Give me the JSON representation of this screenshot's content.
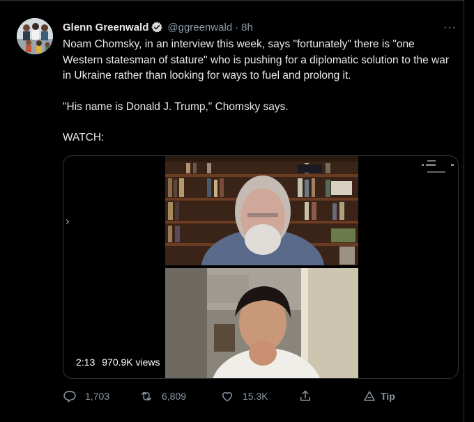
{
  "tweet": {
    "display_name": "Glenn Greenwald",
    "handle": "@ggreenwald",
    "separator": "·",
    "time": "8h",
    "more_label": "···",
    "paragraphs": [
      "Noam Chomsky, in an interview this week, says \"fortunately\" there is \"one Western statesman of stature\" who is pushing for a diplomatic solution to the war in Ukraine rather than looking for ways to fuel and prolong it.",
      "\"His name is Donald J. Trump,\" Chomsky says.",
      "WATCH:"
    ]
  },
  "video": {
    "duration": "2:13",
    "views": "970.9K views"
  },
  "actions": {
    "replies": "1,703",
    "retweets": "6,809",
    "likes": "15.3K",
    "tip_label": "Tip"
  },
  "colors": {
    "background": "#000000",
    "text": "#e7e9ea",
    "secondary": "#8b98a5",
    "verified": "#d9d9d9"
  },
  "icons": [
    "verified-badge-icon",
    "more-icon",
    "reply-icon",
    "retweet-icon",
    "like-icon",
    "share-icon",
    "tip-icon"
  ]
}
